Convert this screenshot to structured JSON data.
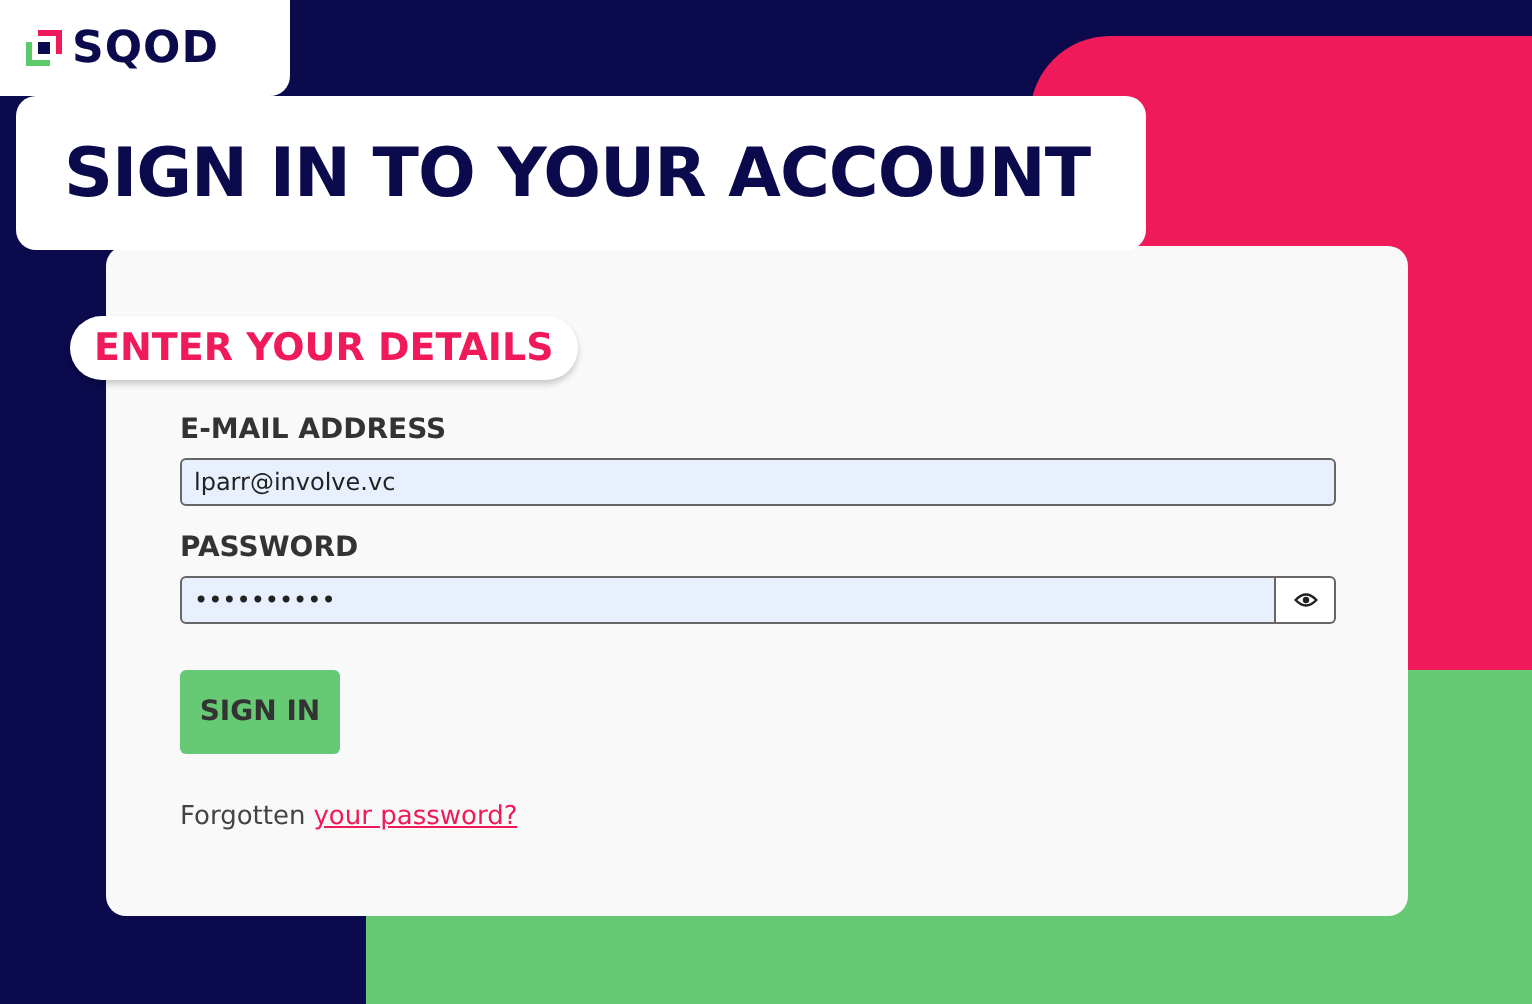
{
  "logo": {
    "text": "SQOD"
  },
  "title": "SIGN IN TO YOUR ACCOUNT",
  "section_badge": "ENTER YOUR DETAILS",
  "fields": [
    {
      "label": "E-MAIL ADDRESS",
      "value": "lparr@involve.vc",
      "kind": "text"
    },
    {
      "label": "PASSWORD",
      "value": "••••••••••",
      "kind": "password"
    }
  ],
  "submit_button": "SIGN IN",
  "forgot": {
    "text": "Forgotten",
    "link": "your password?"
  }
}
